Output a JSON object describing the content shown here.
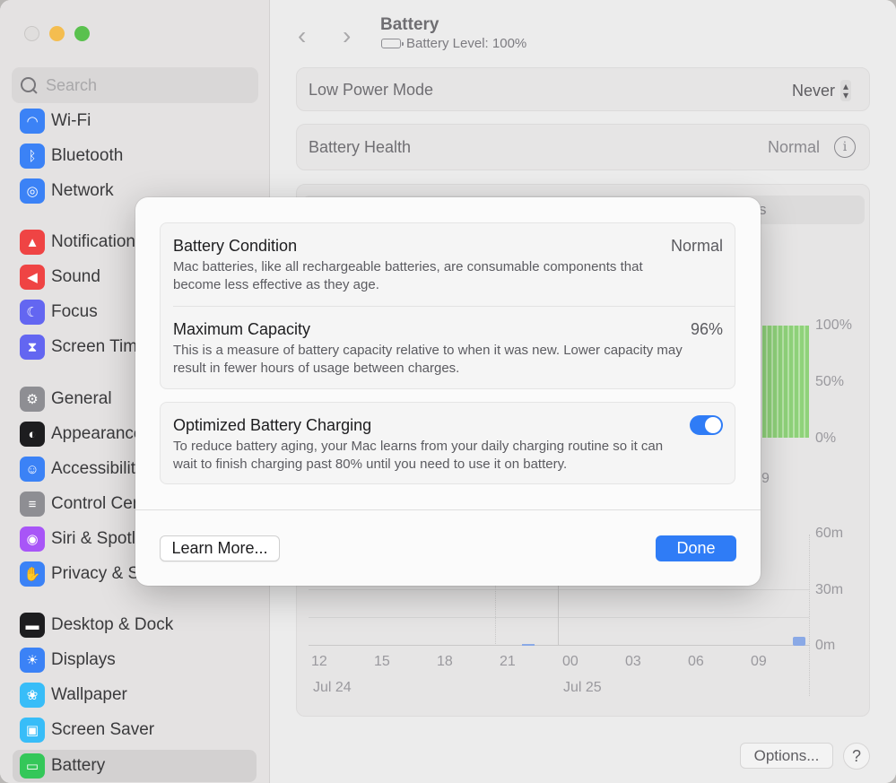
{
  "window": {
    "title": "Battery",
    "subtitle": "Battery Level: 100%"
  },
  "sidebar": {
    "search_placeholder": "Search",
    "items": [
      {
        "label": "Wi-Fi",
        "icon": "wifi-icon",
        "color": "#3b82f6"
      },
      {
        "label": "Bluetooth",
        "icon": "bluetooth-icon",
        "color": "#3b82f6"
      },
      {
        "label": "Network",
        "icon": "globe-icon",
        "color": "#3b82f6"
      },
      {
        "label": "Notifications",
        "icon": "bell-icon",
        "color": "#ef4444"
      },
      {
        "label": "Sound",
        "icon": "speaker-icon",
        "color": "#ef4444"
      },
      {
        "label": "Focus",
        "icon": "moon-icon",
        "color": "#6366f1"
      },
      {
        "label": "Screen Time",
        "icon": "hourglass-icon",
        "color": "#6366f1"
      },
      {
        "label": "General",
        "icon": "gear-icon",
        "color": "#8e8e93"
      },
      {
        "label": "Appearance",
        "icon": "appearance-icon",
        "color": "#1d1d1f"
      },
      {
        "label": "Accessibility",
        "icon": "accessibility-icon",
        "color": "#3b82f6"
      },
      {
        "label": "Control Centre",
        "icon": "control-centre-icon",
        "color": "#8e8e93"
      },
      {
        "label": "Siri & Spotlight",
        "icon": "siri-icon",
        "color": "#a855f7"
      },
      {
        "label": "Privacy & Security",
        "icon": "hand-icon",
        "color": "#3b82f6"
      },
      {
        "label": "Desktop & Dock",
        "icon": "dock-icon",
        "color": "#1d1d1f"
      },
      {
        "label": "Displays",
        "icon": "sun-icon",
        "color": "#3b82f6"
      },
      {
        "label": "Wallpaper",
        "icon": "flower-icon",
        "color": "#38bdf8"
      },
      {
        "label": "Screen Saver",
        "icon": "screensaver-icon",
        "color": "#38bdf8"
      },
      {
        "label": "Battery",
        "icon": "battery-icon",
        "color": "#34c759"
      }
    ]
  },
  "main": {
    "low_power_label": "Low Power Mode",
    "low_power_value": "Never",
    "battery_health_label": "Battery Health",
    "battery_health_value": "Normal",
    "segment_visible_text": "s",
    "level_axis": [
      "100%",
      "50%",
      "0%"
    ],
    "level_partial_label": "9",
    "usage_axis": [
      "60m",
      "30m",
      "0m"
    ],
    "time_ticks": [
      "12",
      "15",
      "18",
      "21",
      "00",
      "03",
      "06",
      "09"
    ],
    "date_labels": [
      "Jul 24",
      "Jul 25"
    ],
    "options_label": "Options...",
    "help_label": "?"
  },
  "dialog": {
    "condition_title": "Battery Condition",
    "condition_value": "Normal",
    "condition_desc": "Mac batteries, like all rechargeable batteries, are consumable components that become less effective as they age.",
    "capacity_title": "Maximum Capacity",
    "capacity_value": "96%",
    "capacity_desc": "This is a measure of battery capacity relative to when it was new. Lower capacity may result in fewer hours of usage between charges.",
    "charging_title": "Optimized Battery Charging",
    "charging_enabled": true,
    "charging_desc": "To reduce battery aging, your Mac learns from your daily charging routine so it can wait to finish charging past 80% until you need to use it on battery.",
    "learn_more_label": "Learn More...",
    "done_label": "Done"
  },
  "colors": {
    "accent": "#2f7cf6",
    "battery_green": "#8fd27a"
  }
}
